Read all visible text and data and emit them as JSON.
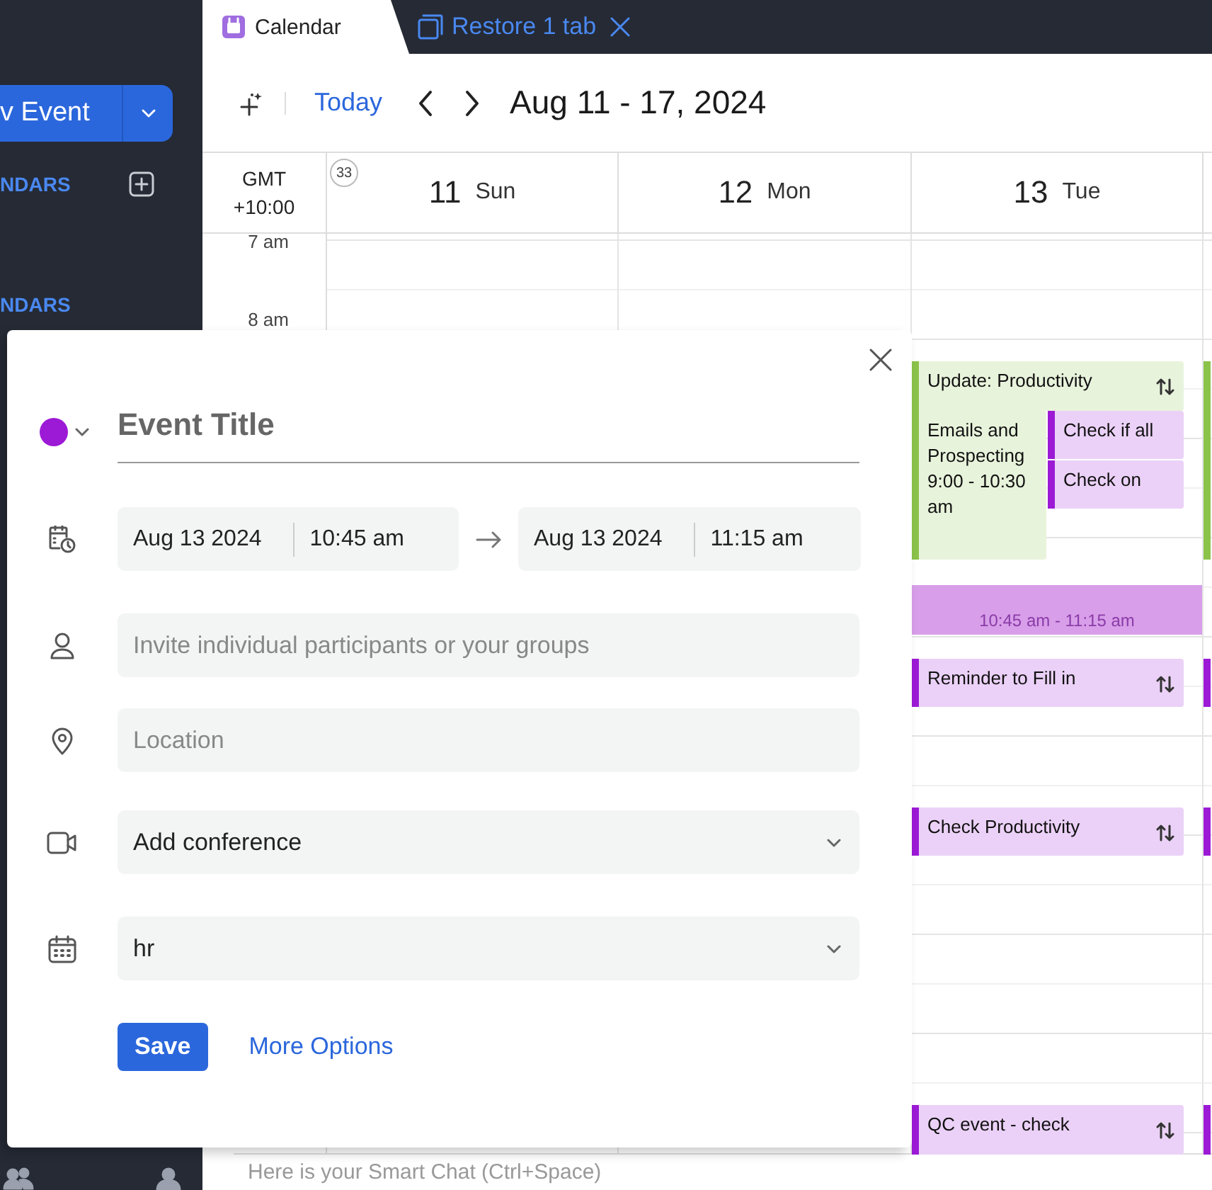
{
  "sidebar": {
    "new_event_button": "v Event",
    "section_labels": [
      "NDARS",
      "NDARS"
    ]
  },
  "tab": {
    "label": "Calendar"
  },
  "restore_tabs": {
    "label": "Restore 1 tab"
  },
  "toolbar": {
    "today": "Today",
    "range": "Aug 11 - 17, 2024"
  },
  "week_view": {
    "timezone": [
      "GMT",
      "+10:00"
    ],
    "week_number": "33",
    "days": [
      {
        "date": "11",
        "weekday": "Sun"
      },
      {
        "date": "12",
        "weekday": "Mon"
      },
      {
        "date": "13",
        "weekday": "Tue"
      }
    ],
    "time_labels": [
      "7 am",
      "8 am"
    ],
    "events": [
      {
        "kind": "event",
        "title": "Update: Productivity",
        "color": "#8bc34a",
        "repeat": true
      },
      {
        "kind": "event",
        "title": "Emails and Prospecting 9:00 - 10:30 am",
        "color": "#8bc34a",
        "repeat": false
      },
      {
        "kind": "event",
        "title": "Check if all",
        "color": "#9c1ad6",
        "repeat": false
      },
      {
        "kind": "event",
        "title": "Check on",
        "color": "#9c1ad6",
        "repeat": false
      },
      {
        "kind": "draft",
        "title": "10:45 am - 11:15 am",
        "color": "#d89ee9"
      },
      {
        "kind": "event",
        "title": "Reminder to Fill in",
        "color": "#9c1ad6",
        "repeat": true
      },
      {
        "kind": "event",
        "title": "Check Productivity",
        "color": "#9c1ad6",
        "repeat": true
      },
      {
        "kind": "event",
        "title": "QC event - check",
        "color": "#9c1ad6",
        "repeat": true
      }
    ],
    "next_day_events": [
      {
        "color": "#8bc34a"
      },
      {
        "color": "#9c1ad6"
      },
      {
        "color": "#9c1ad6"
      },
      {
        "color": "#9c1ad6"
      }
    ]
  },
  "popup": {
    "color": "#9c1ad6",
    "title_placeholder": "Event Title",
    "start": {
      "date": "Aug 13 2024",
      "time": "10:45 am"
    },
    "end": {
      "date": "Aug 13 2024",
      "time": "11:15 am"
    },
    "participants_placeholder": "Invite individual participants or your groups",
    "location_placeholder": "Location",
    "conference": "Add conference",
    "calendar": "hr",
    "save": "Save",
    "more_options": "More Options"
  },
  "smart_chat": {
    "placeholder": "Here is your Smart Chat (Ctrl+Space)"
  }
}
